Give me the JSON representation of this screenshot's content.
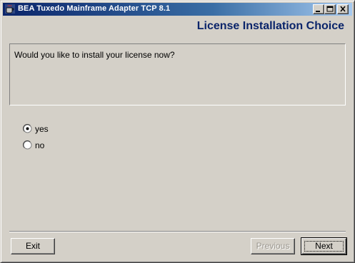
{
  "window": {
    "title": "BEA Tuxedo Mainframe Adapter TCP 8.1",
    "title_icon": "java-cup-icon",
    "controls": [
      "minimize-icon",
      "maximize-icon",
      "close-icon"
    ]
  },
  "page": {
    "heading": "License Installation Choice",
    "prompt": "Would you like to install your license now?"
  },
  "options": [
    {
      "label": "yes",
      "selected": true
    },
    {
      "label": "no",
      "selected": false
    }
  ],
  "buttons": {
    "exit": "Exit",
    "previous": "Previous",
    "previous_enabled": false,
    "next": "Next"
  },
  "colors": {
    "title_bar_start": "#0a246a",
    "title_bar_end": "#a6caf0",
    "heading": "#0a246a",
    "background": "#d4d0c8"
  }
}
